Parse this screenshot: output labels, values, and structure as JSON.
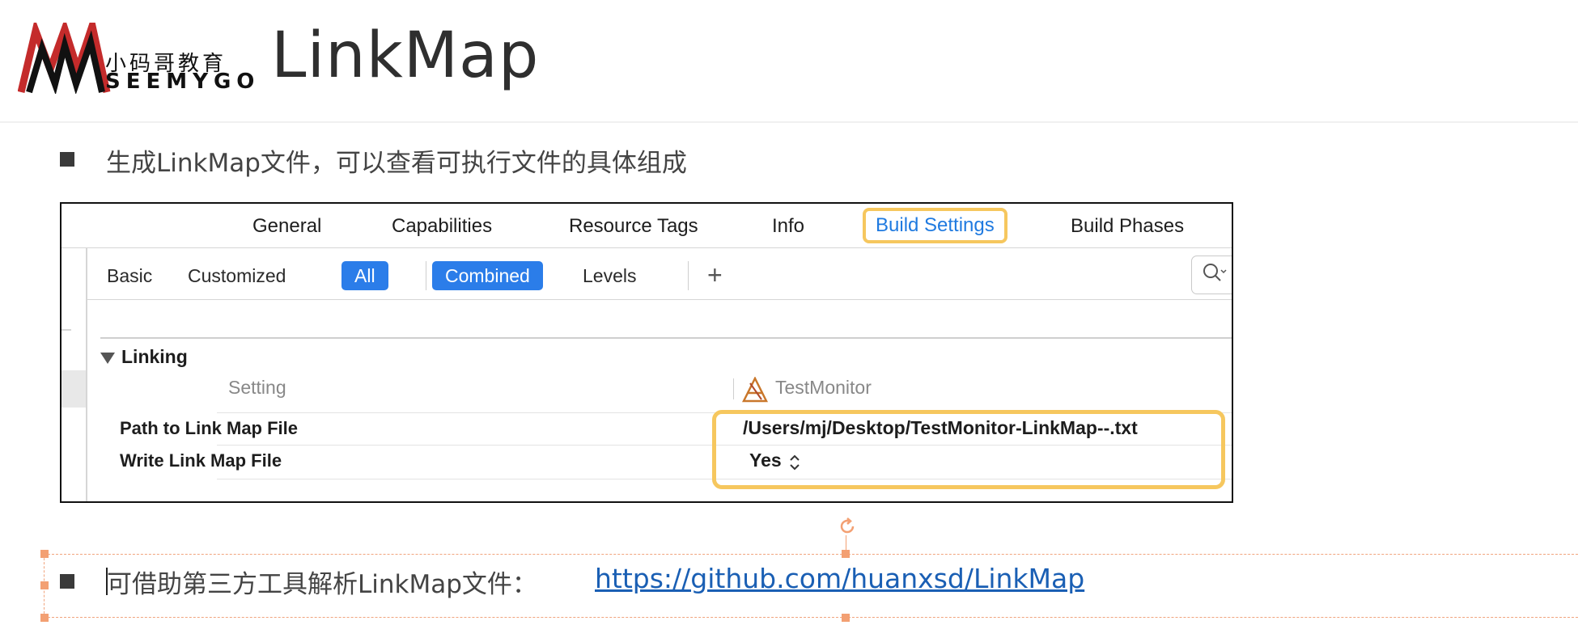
{
  "slide": {
    "title": "LinkMap",
    "logo": {
      "text_cn": "小码哥教育",
      "text_en": "SEEMYGO"
    },
    "bullet1": "生成LinkMap文件，可以查看可执行文件的具体组成",
    "bullet2_text": "可借助第三方工具解析LinkMap文件：",
    "bullet2_link": "https://github.com/huanxsd/LinkMap"
  },
  "xcode": {
    "tabs": [
      "General",
      "Capabilities",
      "Resource Tags",
      "Info",
      "Build Settings",
      "Build Phases"
    ],
    "active_tab": "Build Settings",
    "filters": {
      "basic": "Basic",
      "customized": "Customized",
      "all": "All",
      "combined": "Combined",
      "levels": "Levels",
      "add": "+"
    },
    "section": "Linking",
    "columns": {
      "setting": "Setting",
      "target": "TestMonitor"
    },
    "rows": [
      {
        "key": "Path to Link Map File",
        "value": "/Users/mj/Desktop/TestMonitor-LinkMap--.txt"
      },
      {
        "key": "Write Link Map File",
        "value": "Yes"
      }
    ],
    "colors": {
      "accent": "#2b7de9",
      "highlight": "#f6c75e",
      "tab_active_text": "#1f7ae0"
    },
    "icons": [
      "search-icon",
      "disclosure-triangle-icon",
      "app-target-icon",
      "stepper-icon",
      "plus-icon"
    ]
  },
  "editor": {
    "colors": {
      "selection": "#f3a073"
    },
    "icons": [
      "rotate-handle-icon"
    ]
  }
}
